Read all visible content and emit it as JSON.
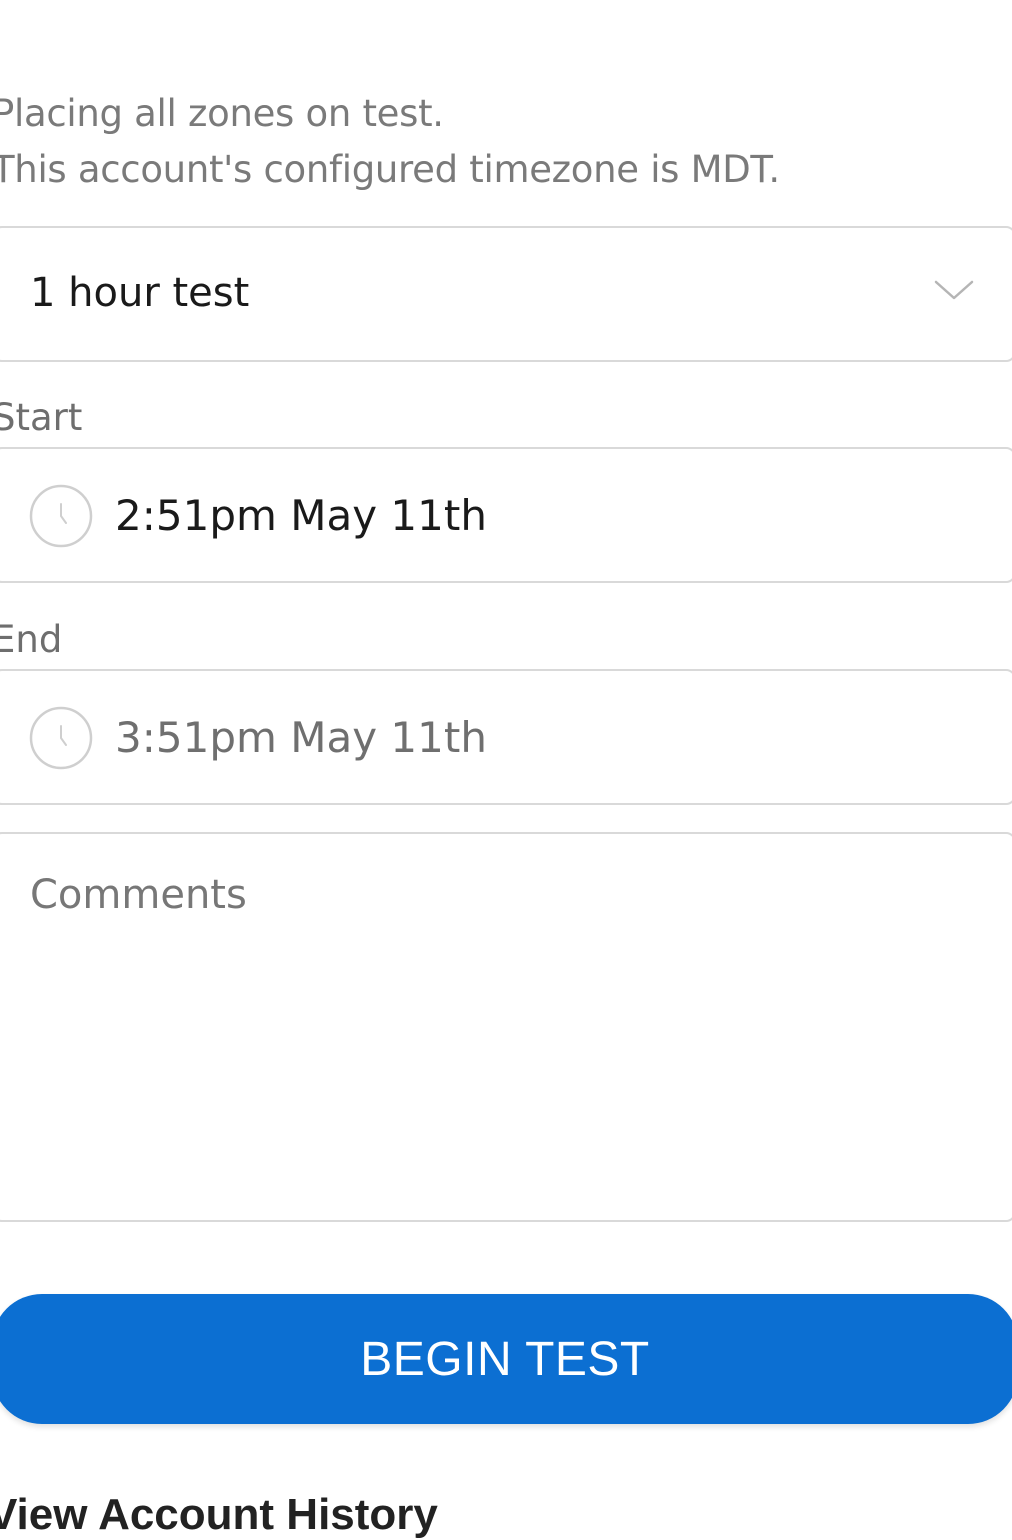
{
  "intro": {
    "line1": "Placing all zones on test.",
    "line2": "This account's configured timezone is MDT."
  },
  "duration": {
    "selected": "1 hour test",
    "icon": "chevron-down-icon"
  },
  "start": {
    "label": "Start",
    "value": "2:51pm May 11th",
    "icon": "clock-icon"
  },
  "end": {
    "label": "End",
    "value": "3:51pm May 11th",
    "icon": "clock-icon"
  },
  "comments": {
    "placeholder": "Comments",
    "value": ""
  },
  "actions": {
    "begin_label": "BEGIN TEST",
    "history_link": "View Account History"
  },
  "colors": {
    "primary": "#0c6fd2",
    "border": "#d9d9d9",
    "muted_text": "#7a7a7a"
  }
}
